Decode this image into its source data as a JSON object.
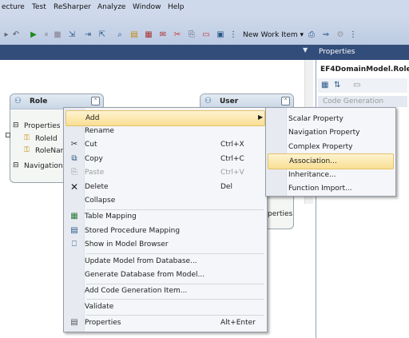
{
  "menubar": {
    "items": [
      "ecture",
      "Test",
      "ReSharper",
      "Analyze",
      "Window",
      "Help"
    ]
  },
  "toolbar": {
    "new_work_item_label": "New Work Item ▾"
  },
  "properties_panel": {
    "title": "Properties",
    "selected_object": "EF4DomainModel.Role",
    "category_label": "Code Generation"
  },
  "role_entity": {
    "title": "Role",
    "properties_label": "Properties",
    "prop_1": "RoleId",
    "prop_2": "RoleNar",
    "navigation_label": "Navigation"
  },
  "user_entity": {
    "title": "User",
    "partial_label": "perties"
  },
  "context_menu": {
    "add": "Add",
    "rename": "Rename",
    "cut": "Cut",
    "cut_shortcut": "Ctrl+X",
    "copy": "Copy",
    "copy_shortcut": "Ctrl+C",
    "paste": "Paste",
    "paste_shortcut": "Ctrl+V",
    "delete": "Delete",
    "delete_shortcut": "Del",
    "collapse": "Collapse",
    "table_mapping": "Table Mapping",
    "stored_procedure_mapping": "Stored Procedure Mapping",
    "show_in_model_browser": "Show in Model Browser",
    "update_model": "Update Model from Database...",
    "generate_database": "Generate Database from Model...",
    "add_code_gen": "Add Code Generation Item...",
    "validate": "Validate",
    "properties": "Properties",
    "properties_shortcut": "Alt+Enter"
  },
  "add_submenu": {
    "scalar_property": "Scalar Property",
    "navigation_property": "Navigation Property",
    "complex_property": "Complex Property",
    "association": "Association...",
    "inheritance": "Inheritance...",
    "function_import": "Function Import..."
  },
  "colors": {
    "highlight": "#f9df93",
    "title_band": "#334d7a",
    "menubar": "#ced9eb"
  }
}
